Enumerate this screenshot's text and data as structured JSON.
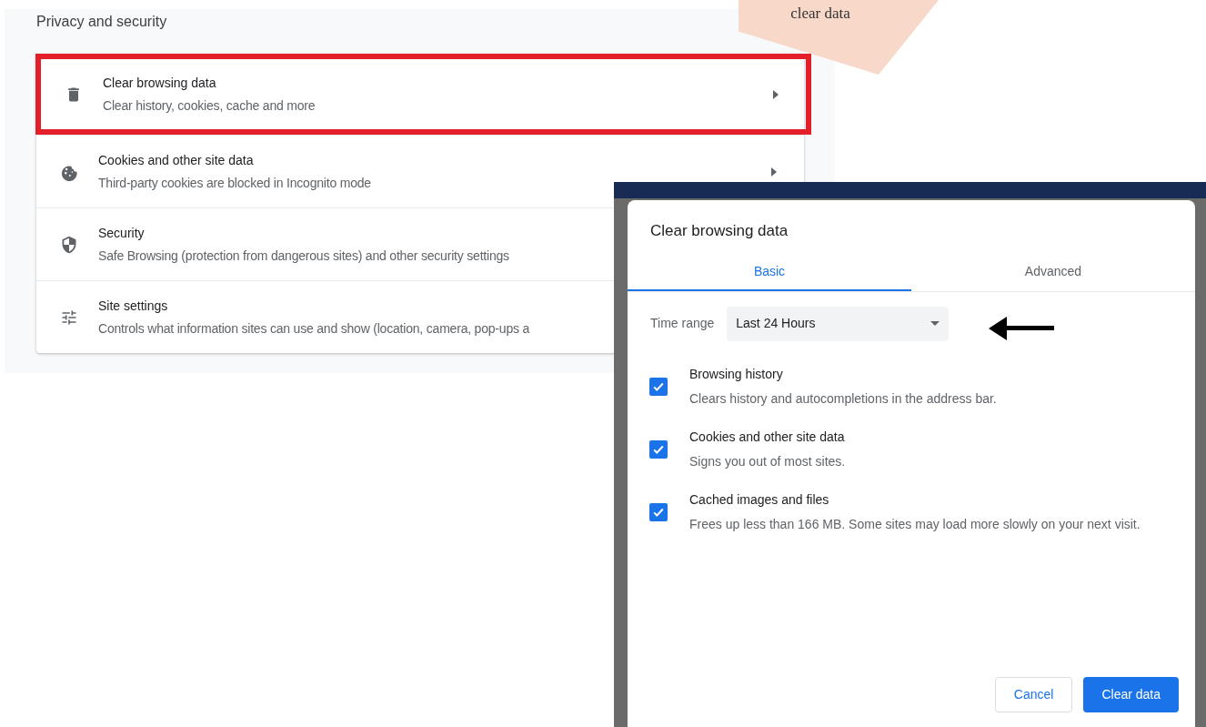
{
  "callout": {
    "text": "clear data"
  },
  "settings": {
    "title": "Privacy and security",
    "rows": [
      {
        "kind": "trash",
        "title": "Clear browsing data",
        "subtitle": "Clear history, cookies, cache and more",
        "highlighted": true,
        "chevron": true
      },
      {
        "kind": "cookie",
        "title": "Cookies and other site data",
        "subtitle": "Third-party cookies are blocked in Incognito mode",
        "highlighted": false,
        "chevron": true
      },
      {
        "kind": "shield",
        "title": "Security",
        "subtitle": "Safe Browsing (protection from dangerous sites) and other security settings",
        "highlighted": false
      },
      {
        "kind": "sliders",
        "title": "Site settings",
        "subtitle": "Controls what information sites can use and show (location, camera, pop-ups a",
        "highlighted": false
      }
    ]
  },
  "dialog": {
    "title": "Clear browsing data",
    "tabs": [
      {
        "label": "Basic",
        "selected": true
      },
      {
        "label": "Advanced",
        "selected": false
      }
    ],
    "time_range": {
      "label": "Time range",
      "value": "Last 24 Hours"
    },
    "options": [
      {
        "title": "Browsing history",
        "description": "Clears history and autocompletions in the address bar.",
        "checked": true
      },
      {
        "title": "Cookies and other site data",
        "description": "Signs you out of most sites.",
        "checked": true
      },
      {
        "title": "Cached images and files",
        "description": "Frees up less than 166 MB. Some sites may load more slowly on your next visit.",
        "checked": true
      }
    ],
    "buttons": [
      {
        "kind": "secondary",
        "label": "Cancel"
      },
      {
        "kind": "primary",
        "label": "Clear data"
      }
    ]
  }
}
